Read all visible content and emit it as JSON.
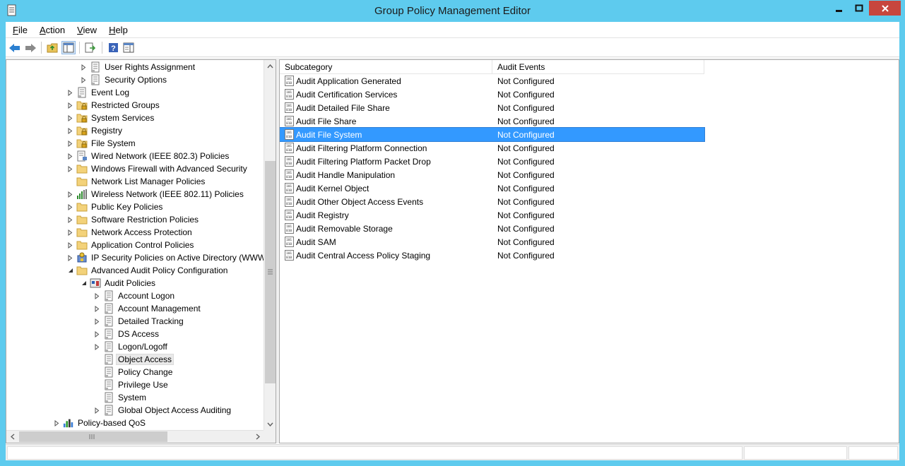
{
  "window": {
    "title": "Group Policy Management Editor"
  },
  "menu": {
    "items": [
      {
        "key": "F",
        "rest": "ile"
      },
      {
        "key": "A",
        "rest": "ction"
      },
      {
        "key": "V",
        "rest": "iew"
      },
      {
        "key": "H",
        "rest": "elp"
      }
    ]
  },
  "toolbar": {
    "buttons": [
      "back-arrow-icon",
      "forward-arrow-icon",
      "up-folder-icon",
      "show-hide-console-tree-icon",
      "export-list-icon",
      "help-icon",
      "properties-pane-icon"
    ]
  },
  "tree": {
    "items": [
      {
        "label": "User Rights Assignment",
        "level": 2,
        "expander": "collapsed",
        "icon": "policy-icon"
      },
      {
        "label": "Security Options",
        "level": 2,
        "expander": "collapsed",
        "icon": "policy-icon"
      },
      {
        "label": "Event Log",
        "level": 1,
        "expander": "collapsed",
        "icon": "policy-icon"
      },
      {
        "label": "Restricted Groups",
        "level": 1,
        "expander": "collapsed",
        "icon": "folder-lock-icon"
      },
      {
        "label": "System Services",
        "level": 1,
        "expander": "collapsed",
        "icon": "folder-lock-icon"
      },
      {
        "label": "Registry",
        "level": 1,
        "expander": "collapsed",
        "icon": "folder-lock-icon"
      },
      {
        "label": "File System",
        "level": 1,
        "expander": "collapsed",
        "icon": "folder-lock-icon"
      },
      {
        "label": "Wired Network (IEEE 802.3) Policies",
        "level": 1,
        "expander": "collapsed",
        "icon": "network-policy-icon"
      },
      {
        "label": "Windows Firewall with Advanced Security",
        "level": 1,
        "expander": "collapsed",
        "icon": "folder-icon"
      },
      {
        "label": "Network List Manager Policies",
        "level": 1,
        "expander": "none",
        "icon": "folder-icon"
      },
      {
        "label": "Wireless Network (IEEE 802.11) Policies",
        "level": 1,
        "expander": "collapsed",
        "icon": "wireless-policy-icon"
      },
      {
        "label": "Public Key Policies",
        "level": 1,
        "expander": "collapsed",
        "icon": "folder-icon"
      },
      {
        "label": "Software Restriction Policies",
        "level": 1,
        "expander": "collapsed",
        "icon": "folder-icon"
      },
      {
        "label": "Network Access Protection",
        "level": 1,
        "expander": "collapsed",
        "icon": "folder-icon"
      },
      {
        "label": "Application Control Policies",
        "level": 1,
        "expander": "collapsed",
        "icon": "folder-icon"
      },
      {
        "label": "IP Security Policies on Active Directory (WWW.",
        "level": 1,
        "expander": "collapsed",
        "icon": "ip-security-icon"
      },
      {
        "label": "Advanced Audit Policy Configuration",
        "level": 1,
        "expander": "expanded",
        "icon": "folder-icon"
      },
      {
        "label": "Audit Policies",
        "level": 2,
        "expander": "expanded",
        "icon": "audit-policies-icon"
      },
      {
        "label": "Account Logon",
        "level": 3,
        "expander": "collapsed",
        "icon": "policy-icon"
      },
      {
        "label": "Account Management",
        "level": 3,
        "expander": "collapsed",
        "icon": "policy-icon"
      },
      {
        "label": "Detailed Tracking",
        "level": 3,
        "expander": "collapsed",
        "icon": "policy-icon"
      },
      {
        "label": "DS Access",
        "level": 3,
        "expander": "collapsed",
        "icon": "policy-icon"
      },
      {
        "label": "Logon/Logoff",
        "level": 3,
        "expander": "collapsed",
        "icon": "policy-icon"
      },
      {
        "label": "Object Access",
        "level": 3,
        "expander": "none",
        "icon": "policy-icon",
        "selected": true
      },
      {
        "label": "Policy Change",
        "level": 3,
        "expander": "none",
        "icon": "policy-icon"
      },
      {
        "label": "Privilege Use",
        "level": 3,
        "expander": "none",
        "icon": "policy-icon"
      },
      {
        "label": "System",
        "level": 3,
        "expander": "none",
        "icon": "policy-icon"
      },
      {
        "label": "Global Object Access Auditing",
        "level": 3,
        "expander": "collapsed",
        "icon": "policy-icon"
      },
      {
        "label": "Policy-based QoS",
        "level": 0,
        "expander": "collapsed",
        "icon": "qos-chart-icon"
      }
    ]
  },
  "list": {
    "columns": [
      "Subcategory",
      "Audit Events"
    ],
    "rows": [
      {
        "subcategory": "Audit Application Generated",
        "events": "Not Configured"
      },
      {
        "subcategory": "Audit Certification Services",
        "events": "Not Configured"
      },
      {
        "subcategory": "Audit Detailed File Share",
        "events": "Not Configured"
      },
      {
        "subcategory": "Audit File Share",
        "events": "Not Configured"
      },
      {
        "subcategory": "Audit File System",
        "events": "Not Configured",
        "selected": true
      },
      {
        "subcategory": "Audit Filtering Platform Connection",
        "events": "Not Configured"
      },
      {
        "subcategory": "Audit Filtering Platform Packet Drop",
        "events": "Not Configured"
      },
      {
        "subcategory": "Audit Handle Manipulation",
        "events": "Not Configured"
      },
      {
        "subcategory": "Audit Kernel Object",
        "events": "Not Configured"
      },
      {
        "subcategory": "Audit Other Object Access Events",
        "events": "Not Configured"
      },
      {
        "subcategory": "Audit Registry",
        "events": "Not Configured"
      },
      {
        "subcategory": "Audit Removable Storage",
        "events": "Not Configured"
      },
      {
        "subcategory": "Audit SAM",
        "events": "Not Configured"
      },
      {
        "subcategory": "Audit Central Access Policy Staging",
        "events": "Not Configured"
      }
    ]
  },
  "colors": {
    "frame": "#5ecbee",
    "selection": "#3399ff",
    "close_button": "#c7463d"
  }
}
